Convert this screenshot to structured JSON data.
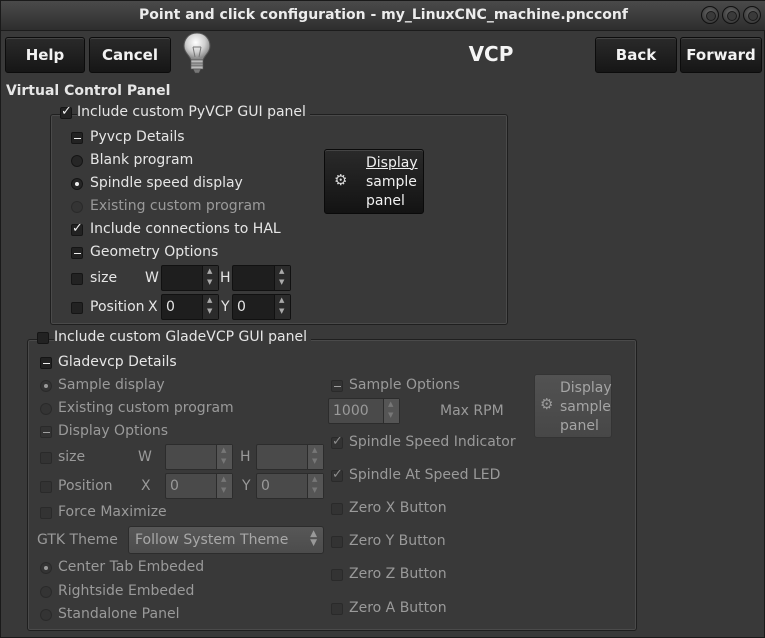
{
  "window": {
    "title": "Point and click configuration - my_LinuxCNC_machine.pncconf"
  },
  "toolbar": {
    "help_label": "Help",
    "cancel_label": "Cancel",
    "page_title": "VCP",
    "back_label": "Back",
    "forward_label": "Forward"
  },
  "section_title": "Virtual Control Panel",
  "pyvcp": {
    "include_label": "Include custom PyVCP GUI panel",
    "include_checked": true,
    "details_label": "Pyvcp Details",
    "blank_program": "Blank program",
    "spindle_speed_display": "Spindle speed display",
    "existing_custom_program": "Existing custom program",
    "include_connections": "Include connections to HAL",
    "geometry_options": "Geometry Options",
    "size_label": "size",
    "w_label": "W",
    "h_label": "H",
    "w_value": "",
    "h_value": "",
    "position_label": "Position",
    "x_label": "X",
    "y_label": "Y",
    "x_value": "0",
    "y_value": "0",
    "display_button": {
      "line1": "Display",
      "line2": "sample",
      "line3": "panel"
    }
  },
  "gladevcp": {
    "include_label": "Include custom GladeVCP GUI panel",
    "include_checked": false,
    "details_label": "Gladevcp Details",
    "sample_display": "Sample display",
    "existing_custom_program": "Existing custom program",
    "display_options": "Display Options",
    "size_label": "size",
    "w_label": "W",
    "h_label": "H",
    "w_value": "",
    "h_value": "",
    "position_label": "Position",
    "x_label": "X",
    "y_label": "Y",
    "x_value": "0",
    "y_value": "0",
    "force_maximize": "Force Maximize",
    "gtk_theme_label": "GTK Theme",
    "gtk_theme_value": "Follow System Theme",
    "center_tab_embeded": "Center Tab Embeded",
    "rightside_embeded": "Rightside Embeded",
    "standalone_panel": "Standalone Panel",
    "sample_options": "Sample Options",
    "max_rpm_value": "1000",
    "max_rpm_label": "Max RPM",
    "spindle_speed_indicator": "Spindle Speed Indicator",
    "spindle_at_speed_led": "Spindle At Speed LED",
    "zero_x": "Zero X Button",
    "zero_y": "Zero Y Button",
    "zero_z": "Zero Z Button",
    "zero_a": "Zero A Button",
    "display_button": {
      "line1": "Display",
      "line2": "sample",
      "line3": "panel"
    }
  }
}
